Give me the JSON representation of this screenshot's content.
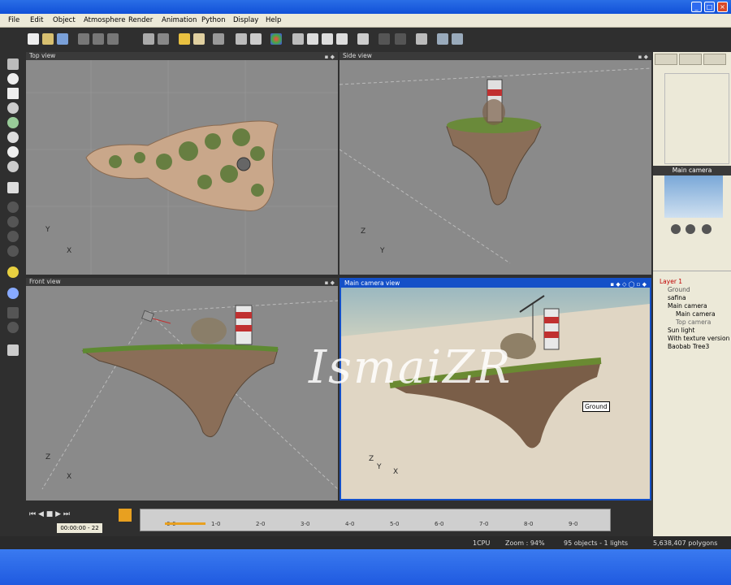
{
  "window": {
    "min_label": "_",
    "max_label": "□",
    "close_label": "×"
  },
  "menu": [
    "File",
    "Edit",
    "Object",
    "Atmosphere",
    "Render",
    "Animation",
    "Python",
    "Display",
    "Help"
  ],
  "viewports": {
    "top": {
      "title": "Top view",
      "axis_y": "Y",
      "axis_x": "X"
    },
    "side": {
      "title": "Side view",
      "axis_z": "Z",
      "axis_y": "Y"
    },
    "front": {
      "title": "Front view",
      "axis_z": "Z",
      "axis_x": "X"
    },
    "camera": {
      "title": "Main camera view",
      "axis_z": "Z",
      "axis_y": "Y",
      "axis_x": "X",
      "tooltip": "Ground"
    }
  },
  "right_panel": {
    "camera_preview_title": "Main camera",
    "tree": [
      {
        "label": "Layer 1",
        "indent": 0,
        "color": "#c00000"
      },
      {
        "label": "Ground",
        "indent": 1,
        "color": "#555555"
      },
      {
        "label": "safina",
        "indent": 1,
        "color": "#000000"
      },
      {
        "label": "Main camera",
        "indent": 1,
        "color": "#000000"
      },
      {
        "label": "Main camera",
        "indent": 2,
        "color": "#000000"
      },
      {
        "label": "Top camera",
        "indent": 2,
        "color": "#666666"
      },
      {
        "label": "Sun light",
        "indent": 1,
        "color": "#000000"
      },
      {
        "label": "With texture version",
        "indent": 1,
        "color": "#000000"
      },
      {
        "label": "Baobab Tree3",
        "indent": 1,
        "color": "#000000"
      }
    ]
  },
  "timeline": {
    "time": "00:00:00 - 22",
    "ticks": [
      "0-0",
      "1-0",
      "2-0",
      "3-0",
      "4-0",
      "5-0",
      "6-0",
      "7-0",
      "8-0",
      "9-0"
    ]
  },
  "status": {
    "cpu": "1CPU",
    "zoom": "Zoom : 94%",
    "objects": "95 objects - 1 lights",
    "polygons": "5,638,407 polygons"
  },
  "watermark": "IsmaiZR",
  "colors": {
    "accent": "#1450c8",
    "panel": "#ece9d8",
    "viewport": "#8a8a8a"
  }
}
